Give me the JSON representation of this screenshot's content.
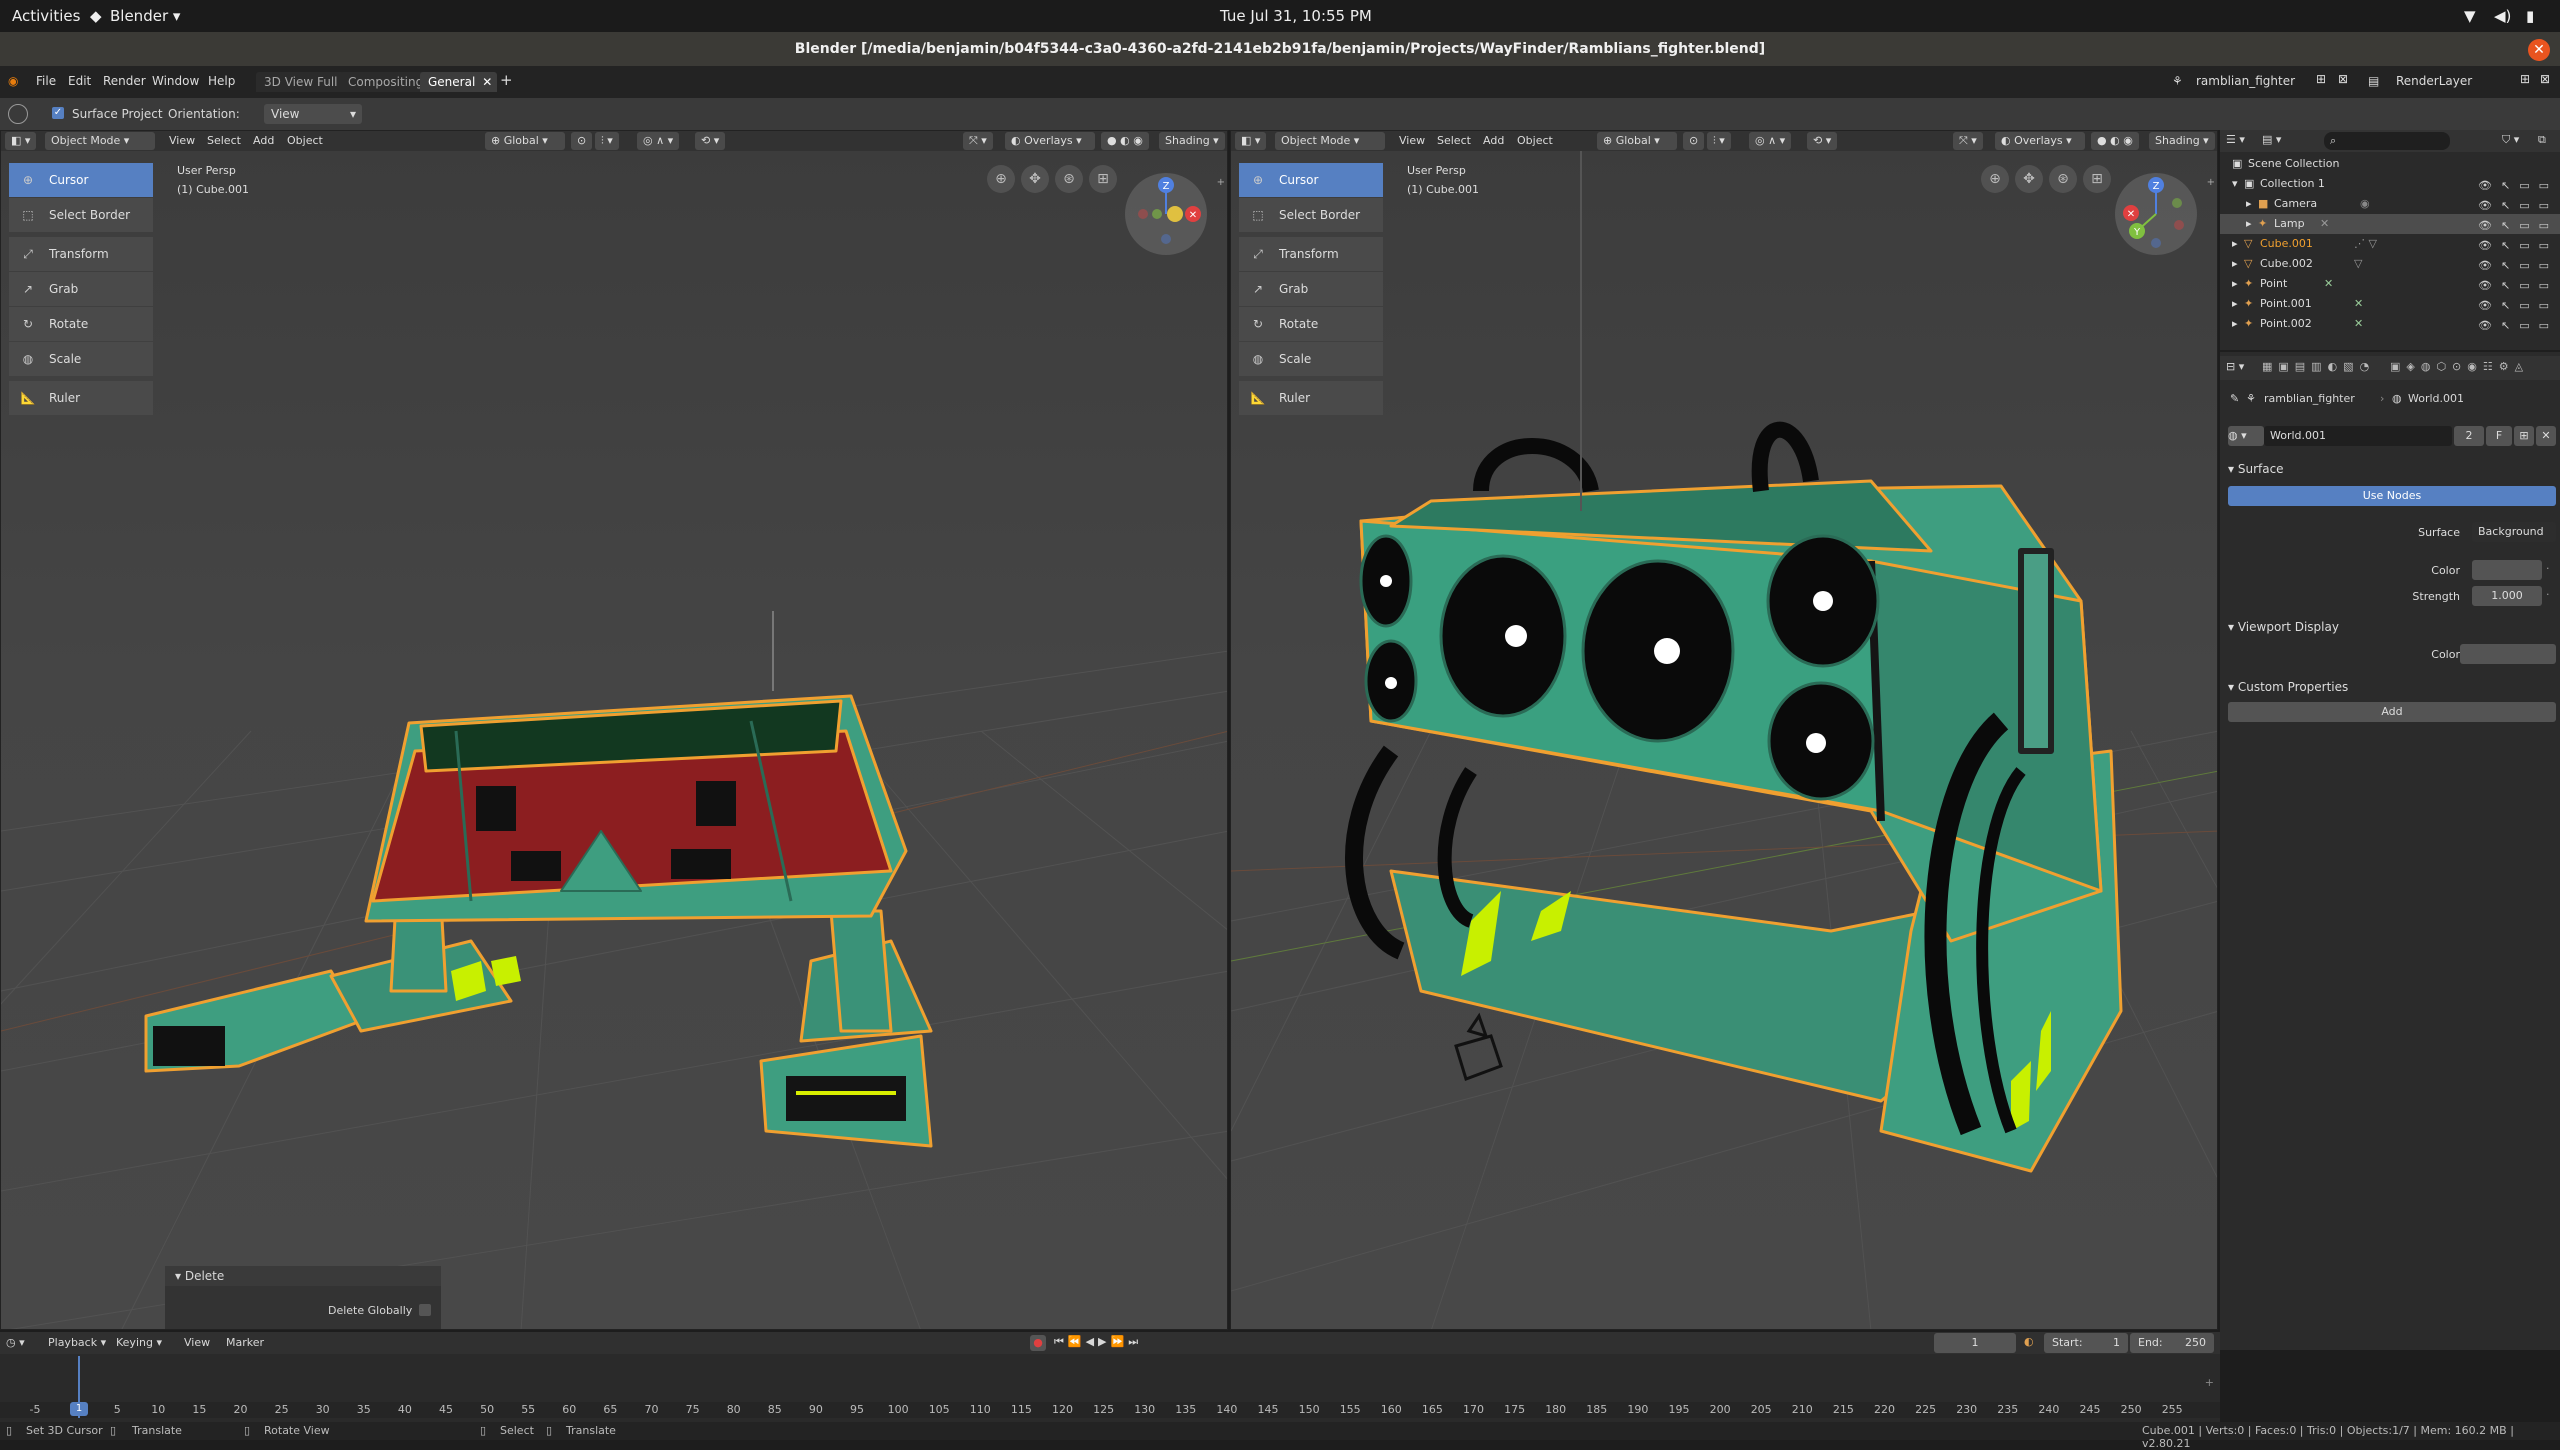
{
  "gnome": {
    "activities": "Activities",
    "app": "Blender ▾",
    "clock": "Tue Jul 31, 10:55 PM"
  },
  "window_title": "Blender [/media/benjamin/b04f5344-c3a0-4360-a2fd-2141eb2b91fa/benjamin/Projects/WayFinder/Ramblians_fighter.blend]",
  "menus": [
    "File",
    "Edit",
    "Render",
    "Window",
    "Help"
  ],
  "workspaces": [
    {
      "label": "3D View Full"
    },
    {
      "label": "Compositing"
    },
    {
      "label": "General"
    }
  ],
  "scene_name": "ramblian_fighter",
  "render_layer": "RenderLayer",
  "toolbar": {
    "surface_project": "Surface Project",
    "orientation_label": "Orientation:",
    "orientation_value": "View"
  },
  "viewport_header": {
    "mode": "Object Mode",
    "menus": [
      "View",
      "Select",
      "Add",
      "Object"
    ],
    "transform": "Global",
    "overlays": "Overlays",
    "shading": "Shading"
  },
  "tools": [
    "Cursor",
    "Select Border",
    "Transform",
    "Grab",
    "Rotate",
    "Scale",
    "Ruler"
  ],
  "viewport_info": {
    "persp": "User Persp",
    "object": "(1) Cube.001"
  },
  "gizmo_axes": {
    "z": "Z",
    "y": "Y"
  },
  "delete_panel": {
    "title": "Delete",
    "option": "Delete Globally"
  },
  "outliner": {
    "items": [
      {
        "label": "Scene Collection"
      },
      {
        "label": "Collection 1"
      },
      {
        "label": "Camera"
      },
      {
        "label": "Lamp"
      },
      {
        "label": "Cube.001"
      },
      {
        "label": "Cube.002"
      },
      {
        "label": "Point"
      },
      {
        "label": "Point.001"
      },
      {
        "label": "Point.002"
      }
    ]
  },
  "properties": {
    "crumb_scene": "ramblian_fighter",
    "crumb_world": "World.001",
    "world_name": "World.001",
    "users": "2",
    "fake": "F",
    "surface_panel": "Surface",
    "use_nodes": "Use Nodes",
    "surface_label": "Surface",
    "surface_value": "Background",
    "color_label": "Color",
    "strength_label": "Strength",
    "strength_value": "1.000",
    "viewport_display": "Viewport Display",
    "vd_color_label": "Color",
    "custom_props": "Custom Properties",
    "add_label": "Add"
  },
  "timeline": {
    "menus": [
      "Playback",
      "Keying",
      "View",
      "Marker"
    ],
    "current_frame": "1",
    "start_label": "Start:",
    "start_value": "1",
    "end_label": "End:",
    "end_value": "250",
    "ruler": [
      "-5",
      "0",
      "5",
      "10",
      "15",
      "20",
      "25",
      "30",
      "35",
      "40",
      "45",
      "50",
      "55",
      "60",
      "65",
      "70",
      "75",
      "80",
      "85",
      "90",
      "95",
      "100",
      "105",
      "110",
      "115",
      "120",
      "125",
      "130",
      "135",
      "140",
      "145",
      "150",
      "155",
      "160",
      "165",
      "170",
      "175",
      "180",
      "185",
      "190",
      "195",
      "200",
      "205",
      "210",
      "215",
      "220",
      "225",
      "230",
      "235",
      "240",
      "245",
      "250",
      "255"
    ]
  },
  "status": {
    "set_cursor": "Set 3D Cursor",
    "translate1": "Translate",
    "rotate_view": "Rotate View",
    "select": "Select",
    "translate2": "Translate",
    "stats": "Cube.001 | Verts:0 | Faces:0 | Tris:0 | Objects:1/7 | Mem: 160.2 MB | v2.80.21"
  },
  "colors": {
    "accent": "#5680c2",
    "selection_outline": "#f0a030",
    "model_teal": "#3e9e80",
    "model_red": "#8c1e20",
    "glow": "#c8f000"
  }
}
